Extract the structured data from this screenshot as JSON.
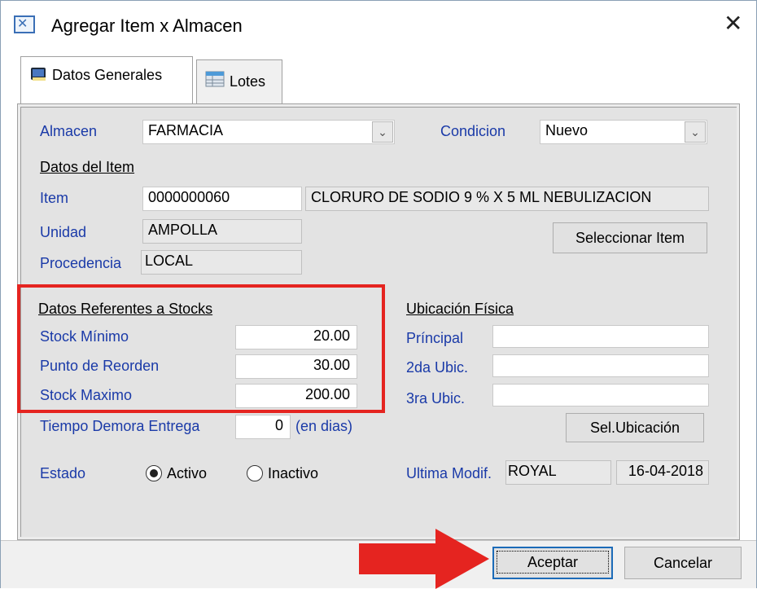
{
  "window": {
    "title": "Agregar Item x Almacen",
    "icon": "app-icon",
    "close_icon": "close-icon"
  },
  "tabs": [
    {
      "label": "Datos Generales",
      "icon": "book-icon",
      "active": true
    },
    {
      "label": "Lotes",
      "icon": "table-icon",
      "active": false
    }
  ],
  "general": {
    "almacen_label": "Almacen",
    "almacen_value": "FARMACIA",
    "condicion_label": "Condicion",
    "condicion_value": "Nuevo",
    "datos_item_header": "Datos del Item",
    "item_label": "Item",
    "item_code": "0000000060",
    "item_desc": "CLORURO DE SODIO 9 % X 5 ML NEBULIZACION",
    "unidad_label": "Unidad",
    "unidad_value": "AMPOLLA",
    "procedencia_label": "Procedencia",
    "procedencia_value": "LOCAL",
    "select_item_button": "Seleccionar Item"
  },
  "stocks": {
    "header": "Datos Referentes a Stocks",
    "min_label": "Stock Mínimo",
    "min_value": "20.00",
    "reorder_label": "Punto de Reorden",
    "reorder_value": "30.00",
    "max_label": "Stock Maximo",
    "max_value": "200.00"
  },
  "ubicacion": {
    "header": "Ubicación Física",
    "principal_label": "Príncipal",
    "principal_value": "",
    "second_label": "2da Ubic.",
    "second_value": "",
    "third_label": "3ra Ubic.",
    "third_value": "",
    "select_button": "Sel.Ubicación"
  },
  "demora": {
    "label": "Tiempo Demora Entrega",
    "value": "0",
    "unit": "(en dias)"
  },
  "estado": {
    "label": "Estado",
    "active_label": "Activo",
    "inactive_label": "Inactivo",
    "selected": "Activo"
  },
  "modif": {
    "label": "Ultima Modif.",
    "user": "ROYAL",
    "date": "16-04-2018"
  },
  "footer": {
    "accept_button": "Aceptar",
    "cancel_button": "Cancelar"
  },
  "colors": {
    "highlight_box": "#e52420",
    "arrow": "#e52420",
    "label_blue": "#1a3aa8",
    "focus_border": "#1c6bb8"
  }
}
